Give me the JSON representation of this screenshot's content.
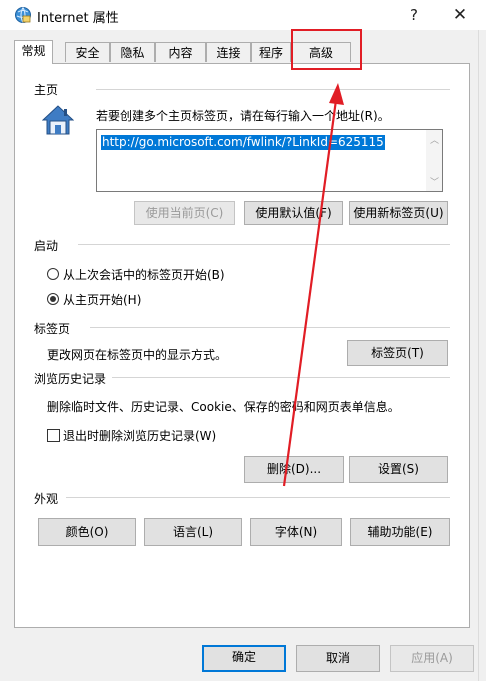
{
  "window": {
    "title": "Internet 属性",
    "help_glyph": "?",
    "close_glyph": "✕"
  },
  "tabs": [
    {
      "label": "常规",
      "active": true
    },
    {
      "label": "安全"
    },
    {
      "label": "隐私"
    },
    {
      "label": "内容"
    },
    {
      "label": "连接"
    },
    {
      "label": "程序"
    },
    {
      "label": "高级"
    }
  ],
  "homepage": {
    "group_label": "主页",
    "description": "若要创建多个主页标签页，请在每行输入一个地址(R)。",
    "url": "http://go.microsoft.com/fwlink/?LinkId=625115",
    "buttons": {
      "use_current": "使用当前页(C)",
      "use_default": "使用默认值(F)",
      "use_new_tab": "使用新标签页(U)"
    }
  },
  "startup": {
    "group_label": "启动",
    "option_last_session": "从上次会话中的标签页开始(B)",
    "option_home": "从主页开始(H)",
    "selected": "home"
  },
  "tabs_section": {
    "group_label": "标签页",
    "description": "更改网页在标签页中的显示方式。",
    "button": "标签页(T)"
  },
  "history": {
    "group_label": "浏览历史记录",
    "description": "删除临时文件、历史记录、Cookie、保存的密码和网页表单信息。",
    "checkbox_label": "退出时删除浏览历史记录(W)",
    "delete_button": "删除(D)...",
    "settings_button": "设置(S)"
  },
  "appearance": {
    "group_label": "外观",
    "colors": "颜色(O)",
    "languages": "语言(L)",
    "fonts": "字体(N)",
    "accessibility": "辅助功能(E)"
  },
  "footer": {
    "ok": "确定",
    "cancel": "取消",
    "apply": "应用(A)"
  },
  "colors": {
    "annotation": "#e11d25",
    "selection": "#0078d7",
    "default_button_border": "#0078d7"
  }
}
